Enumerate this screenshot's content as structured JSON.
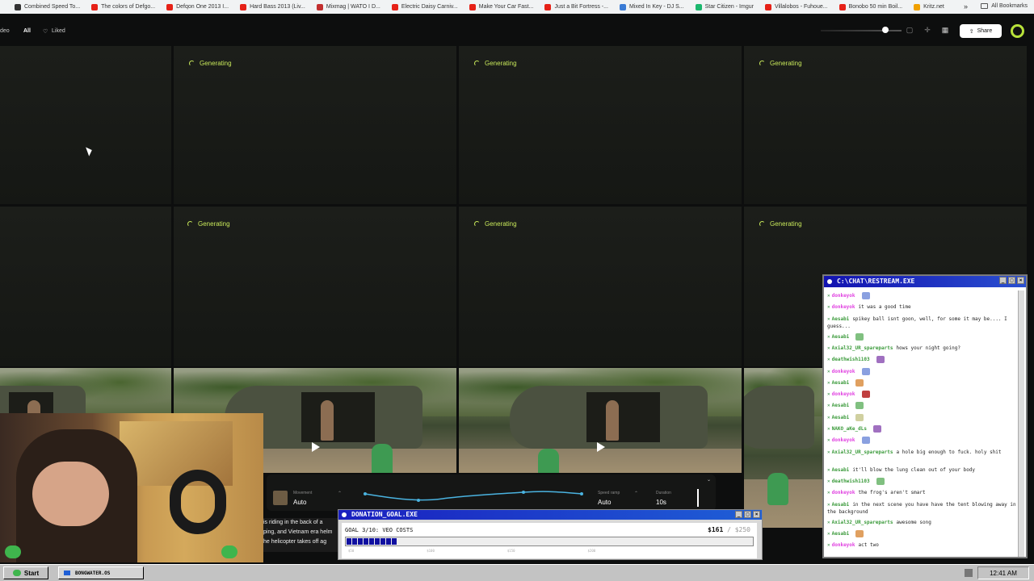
{
  "bookmarks": {
    "items": [
      {
        "label": "Combined Speed To...",
        "color": "#333333"
      },
      {
        "label": "The colors of Defgo...",
        "color": "#e62117"
      },
      {
        "label": "Defqon One 2013 I...",
        "color": "#e62117"
      },
      {
        "label": "Hard Bass 2013 (Liv...",
        "color": "#e62117"
      },
      {
        "label": "Mixmag | WATO I D...",
        "color": "#c22f2f"
      },
      {
        "label": "Electric Daisy Carniv...",
        "color": "#e62117"
      },
      {
        "label": "Make Your Car Fast...",
        "color": "#e62117"
      },
      {
        "label": "Just a Bit Fortress -...",
        "color": "#e62117"
      },
      {
        "label": "Mixed In Key - DJ S...",
        "color": "#3a7bd5"
      },
      {
        "label": "Star Citizen - Imgur",
        "color": "#1bb76e"
      },
      {
        "label": "Villalobos - Fuhoue...",
        "color": "#e62117"
      },
      {
        "label": "Bonobo 50 min Boil...",
        "color": "#e62117"
      },
      {
        "label": "Kritz.net",
        "color": "#f0a000"
      }
    ],
    "more": "»",
    "all_bookmarks": "All Bookmarks"
  },
  "header": {
    "left_cut": "deo",
    "filter_all": "All",
    "liked": "Liked",
    "share": "Share"
  },
  "grid": {
    "generating_label": "Generating"
  },
  "controls": {
    "movement_label": "Movement",
    "movement_value": "Auto",
    "speed_ramp_label": "Speed ramp",
    "speed_ramp_value": "Auto",
    "duration_label": "Duration",
    "duration_value": "10s"
  },
  "caption": {
    "line1": "is riding in the back of a",
    "line2": "ping, and Vietnam era helm",
    "line3": "he helicopter takes off ag"
  },
  "donation": {
    "title": "DONATION_GOAL.EXE",
    "goal_text": "GOAL 3/10: VEO COSTS",
    "current": "$161",
    "total": "$250",
    "progress_fraction": 0.644,
    "ticks": [
      "$50",
      "$100",
      "$150",
      "$200"
    ]
  },
  "chat": {
    "title": "C:\\CHAT\\RESTREAM.EXE",
    "messages": [
      {
        "user": "donkeyok",
        "text": "",
        "user_color": "#e040e0",
        "emote": true
      },
      {
        "user": "donkeyok",
        "text": "it was a good time",
        "user_color": "#e040e0"
      },
      {
        "user": "Aesabi",
        "text": "spikey ball isnt goon, well, for some it may be.... I guess...",
        "user_color": "#3a9a3a"
      },
      {
        "user": "Aesabi",
        "text": "",
        "user_color": "#3a9a3a",
        "emote": true
      },
      {
        "user": "Axial32_UR_spareparts",
        "text": "hows your night going?",
        "user_color": "#3a9a3a"
      },
      {
        "user": "deathwish1103",
        "text": "",
        "user_color": "#3a9a3a",
        "emote": true
      },
      {
        "user": "donkeyok",
        "text": "",
        "user_color": "#e040e0",
        "emote": true
      },
      {
        "user": "Aesabi",
        "text": "",
        "user_color": "#3a9a3a",
        "emote": true
      },
      {
        "user": "donkeyok",
        "text": "",
        "user_color": "#e040e0",
        "emote": true
      },
      {
        "user": "Aesabi",
        "text": "",
        "user_color": "#3a9a3a",
        "emote": true
      },
      {
        "user": "Aesabi",
        "text": "",
        "user_color": "#3a9a3a",
        "emote": true
      },
      {
        "user": "NAKO_aKe_dLs",
        "text": "",
        "user_color": "#3a9a3a",
        "emote": true
      },
      {
        "user": "donkeyok",
        "text": "",
        "user_color": "#e040e0",
        "emote": true
      },
      {
        "user": "Axial32_UR_spareparts",
        "text": "a hole big enough to fuck. holy shit",
        "user_color": "#3a9a3a"
      },
      {
        "user": "Aesabi",
        "text": "it'll blow the lung clean out of your body",
        "user_color": "#3a9a3a"
      },
      {
        "user": "deathwish1103",
        "text": "",
        "user_color": "#3a9a3a",
        "emote": true
      },
      {
        "user": "donkeyok",
        "text": "the frog's aren't smart",
        "user_color": "#e040e0"
      },
      {
        "user": "Aesabi",
        "text": "in the next scene you have have the tent blowing away in the background",
        "user_color": "#3a9a3a"
      },
      {
        "user": "Axial32_UR_spareparts",
        "text": "awesome song",
        "user_color": "#3a9a3a"
      },
      {
        "user": "Aesabi",
        "text": "",
        "user_color": "#3a9a3a",
        "emote": true
      },
      {
        "user": "donkeyok",
        "text": "act two",
        "user_color": "#e040e0"
      }
    ]
  },
  "taskbar": {
    "start": "Start",
    "task": "BONGWATER.OS",
    "clock": "12:41 AM"
  }
}
